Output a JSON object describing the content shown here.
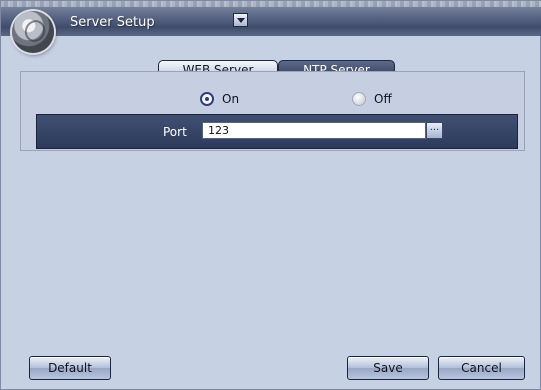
{
  "window": {
    "title": "Server Setup",
    "dropdown_icon": "chevron-down-icon"
  },
  "tabs": [
    {
      "label": "WEB Server",
      "active": false
    },
    {
      "label": "NTP Server",
      "active": true
    }
  ],
  "ntp": {
    "on_label": "On",
    "off_label": "Off",
    "selected": "On",
    "port_label": "Port",
    "port_value": "123",
    "more_button": "..."
  },
  "buttons": {
    "default": "Default",
    "save": "Save",
    "cancel": "Cancel"
  },
  "colors": {
    "active_tab": "#2d3858",
    "background": "#c9d3e5"
  }
}
